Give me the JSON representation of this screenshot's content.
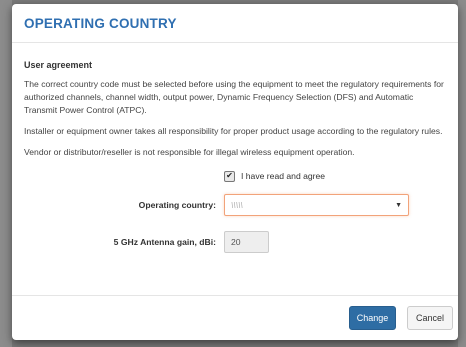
{
  "dialog": {
    "title": "OPERATING COUNTRY",
    "section_title": "User agreement",
    "paragraphs": [
      "The correct country code must be selected before using the equipment to meet the regulatory requirements for authorized channels, channel width, output power, Dynamic Frequency Selection (DFS) and Automatic Transmit Power Control (ATPC).",
      "Installer or equipment owner takes all responsibility for proper product usage according to the regulatory rules.",
      "Vendor or distributor/reseller is not responsible for illegal wireless equipment operation."
    ],
    "agree_label": "I have read and agree",
    "agree_checked": true,
    "country_label": "Operating country:",
    "country_value": "\\\\\\\\\\",
    "gain_label": "5 GHz Antenna gain, dBi:",
    "gain_value": "20",
    "change_label": "Change",
    "cancel_label": "Cancel",
    "check_glyph": "✔",
    "caret_glyph": "▼"
  },
  "colors": {
    "title": "#2f6fb1",
    "primary_button": "#2e6da4",
    "focus_border": "#f2a37a"
  }
}
